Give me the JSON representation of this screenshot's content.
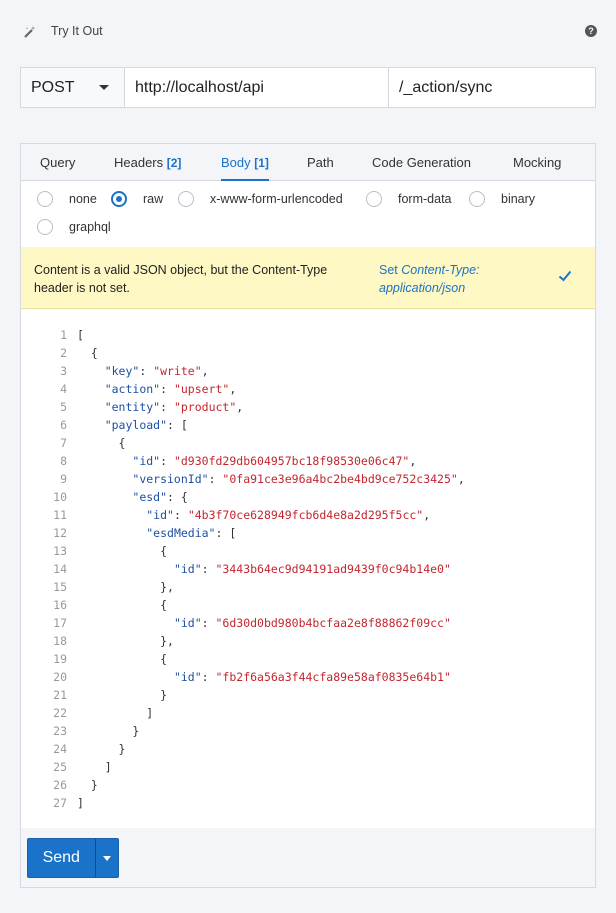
{
  "header": {
    "title": "Try It Out",
    "wand_icon": "magic-wand-icon",
    "help_icon": "help-icon"
  },
  "request": {
    "method": "POST",
    "base_url": "http://localhost/api",
    "path": "/_action/sync"
  },
  "tabs": [
    {
      "label": "Query",
      "count": ""
    },
    {
      "label": "Headers",
      "count": "[2]"
    },
    {
      "label": "Body",
      "count": "[1]"
    },
    {
      "label": "Path",
      "count": ""
    },
    {
      "label": "Code Generation",
      "count": ""
    },
    {
      "label": "Mocking",
      "count": ""
    }
  ],
  "body_types": [
    "none",
    "raw",
    "x-www-form-urlencoded",
    "form-data",
    "binary",
    "graphql"
  ],
  "selected_body_type": "raw",
  "notice": {
    "message": "Content is a valid JSON object, but the Content-Type header is not set.",
    "action_prefix": "Set",
    "action_value": "Content-Type: application/json",
    "check_icon": "checkmark-icon"
  },
  "editor": {
    "lines": [
      "[",
      "  {",
      "    \"key\": \"write\",",
      "    \"action\": \"upsert\",",
      "    \"entity\": \"product\",",
      "    \"payload\": [",
      "      {",
      "        \"id\": \"d930fd29db604957bc18f98530e06c47\",",
      "        \"versionId\": \"0fa91ce3e96a4bc2be4bd9ce752c3425\",",
      "        \"esd\": {",
      "          \"id\": \"4b3f70ce628949fcb6d4e8a2d295f5cc\",",
      "          \"esdMedia\": [",
      "            {",
      "              \"id\": \"3443b64ec9d94191ad9439f0c94b14e0\"",
      "            },",
      "            {",
      "              \"id\": \"6d30d0bd980b4bcfaa2e8f88862f09cc\"",
      "            },",
      "            {",
      "              \"id\": \"fb2f6a56a3f44cfa89e58af0835e64b1\"",
      "            }",
      "          ]",
      "        }",
      "      }",
      "    ]",
      "  }",
      "]"
    ]
  },
  "footer": {
    "send_label": "Send",
    "dropdown_icon": "caret-down-icon"
  },
  "colors": {
    "accent": "#1a73c8",
    "notice_bg": "#fdf8c4",
    "json_key": "#1f4fa3",
    "json_string": "#c4262e"
  }
}
